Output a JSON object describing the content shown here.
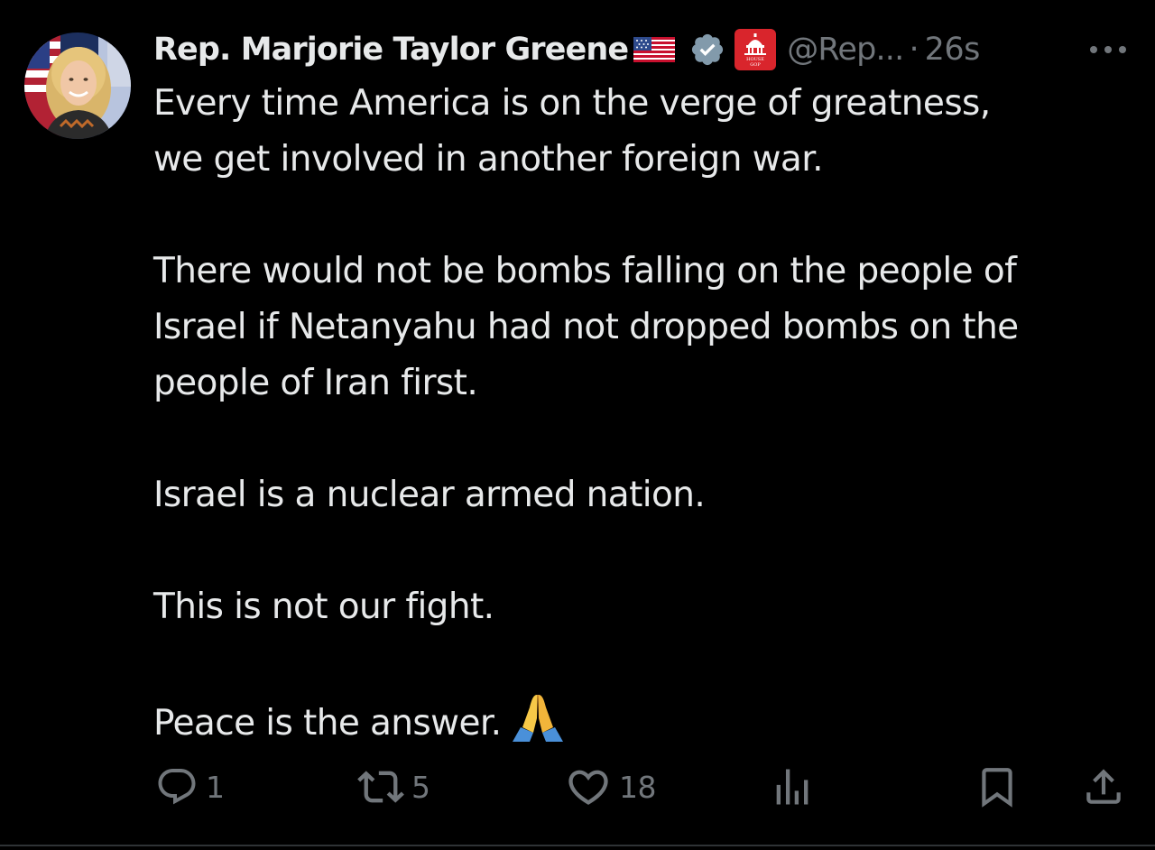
{
  "author": {
    "display_name": "Rep. Marjorie Taylor Greene",
    "handle": "@Rep...",
    "separator": "·",
    "timestamp": "26s",
    "flag_icon": "us-flag-icon",
    "verified_icon": "verified-badge-icon",
    "affiliation_badge": {
      "icon": "house-gop-logo-icon",
      "text_line1": "HOUSE",
      "text_line2": "GOP",
      "color": "#d9252c"
    }
  },
  "tweet": {
    "paragraphs": [
      {
        "lines": [
          "Every time America is on the verge of greatness,",
          "we get involved in another foreign war."
        ]
      },
      {
        "lines": [
          "There would not be bombs falling on the people of",
          "Israel if Netanyahu had not dropped bombs on the",
          "people of Iran first."
        ]
      },
      {
        "lines": [
          "Israel is a nuclear armed nation."
        ]
      },
      {
        "lines": [
          "This is not our fight."
        ]
      },
      {
        "lines": [
          "Peace is the answer."
        ],
        "trailing_emoji": "folded-hands-emoji"
      }
    ]
  },
  "actions": {
    "reply": {
      "icon": "reply-icon",
      "count": "1"
    },
    "repost": {
      "icon": "repost-icon",
      "count": "5"
    },
    "like": {
      "icon": "heart-icon",
      "count": "18"
    },
    "views": {
      "icon": "views-chart-icon",
      "count": ""
    },
    "bookmark": {
      "icon": "bookmark-icon"
    },
    "share": {
      "icon": "share-icon"
    }
  },
  "colors": {
    "background": "#000000",
    "primary_text": "#e7e9ea",
    "secondary_text": "#71767b",
    "verified": "#829aab",
    "divider": "#2f3336"
  }
}
